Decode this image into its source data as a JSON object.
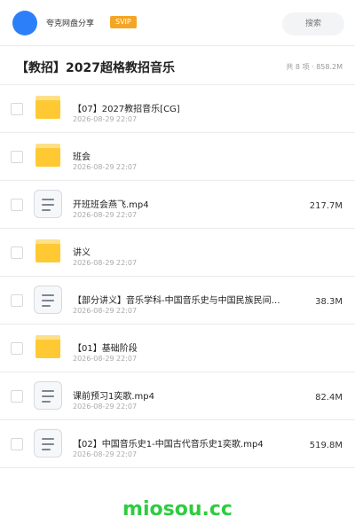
{
  "header": {
    "brand": "夸克网盘分享",
    "badge": "SVIP",
    "search_placeholder": "搜索"
  },
  "folder": {
    "title": "【教招】2027超格教招音乐",
    "meta": "共 8 项 · 858.2M"
  },
  "items": [
    {
      "type": "folder",
      "name": "【07】2027教招音乐[CG]",
      "date": "2026-08-29 22:07",
      "size": ""
    },
    {
      "type": "folder",
      "name": "班会",
      "date": "2026-08-29 22:07",
      "size": ""
    },
    {
      "type": "file",
      "name": "开班班会燕飞.mp4",
      "date": "2026-08-29 22:07",
      "size": "217.7M"
    },
    {
      "type": "folder",
      "name": "讲义",
      "date": "2026-08-29 22:07",
      "size": ""
    },
    {
      "type": "file",
      "name": "【部分讲义】音乐学科-中国音乐史与中国民族民间音乐…",
      "date": "2026-08-29 22:07",
      "size": "38.3M"
    },
    {
      "type": "folder",
      "name": "【01】基础阶段",
      "date": "2026-08-29 22:07",
      "size": ""
    },
    {
      "type": "file",
      "name": "课前预习1奕歌.mp4",
      "date": "2026-08-29 22:07",
      "size": "82.4M"
    },
    {
      "type": "file",
      "name": "【02】中国音乐史1-中国古代音乐史1奕歌.mp4",
      "date": "2026-08-29 22:07",
      "size": "519.8M"
    }
  ],
  "watermark": "miosou.cc",
  "colors": {
    "accent": "#2d7ff9",
    "badge": "#f5a524",
    "folder": "#ffc933",
    "watermark": "#2ecc40"
  }
}
